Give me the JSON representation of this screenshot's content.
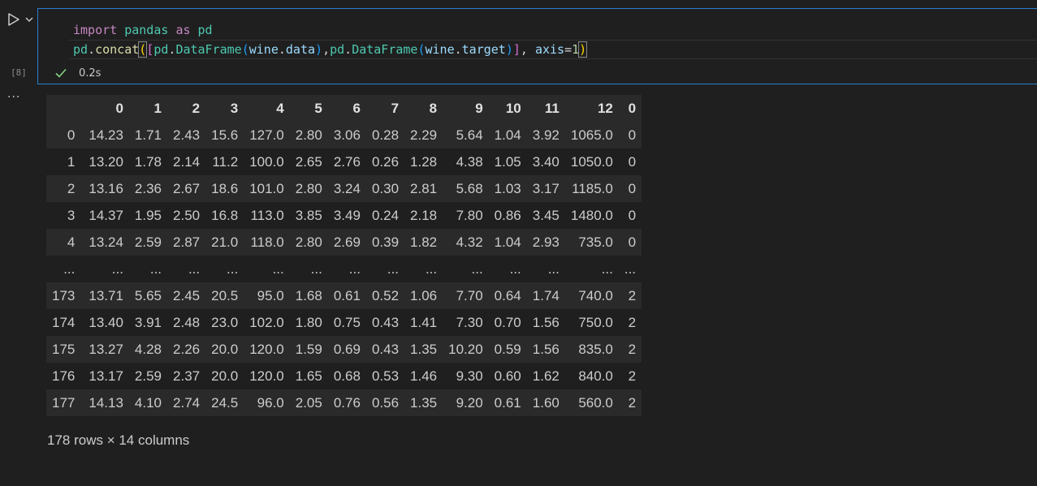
{
  "cell": {
    "execution_count": "[8]",
    "status_time": "0.2s",
    "code": {
      "line1": {
        "import_kw": "import",
        "module": "pandas",
        "as_kw": "as",
        "alias": "pd"
      },
      "line2": {
        "obj": "pd",
        "dot1": ".",
        "fn": "concat",
        "p1": "(",
        "b1": "[",
        "obj2": "pd",
        "dot2": ".",
        "cls1": "DataFrame",
        "p2": "(",
        "var1": "wine",
        "dot3": ".",
        "attr1": "data",
        "p3": ")",
        "comma1": ",",
        "obj3": "pd",
        "dot4": ".",
        "cls2": "DataFrame",
        "p4": "(",
        "var2": "wine",
        "dot5": ".",
        "attr2": "target",
        "p5": ")",
        "b2": "]",
        "comma2": ", ",
        "kwarg": "axis",
        "eq": "=",
        "num": "1",
        "p6": ")"
      }
    }
  },
  "output": {
    "columns": [
      "",
      "0",
      "1",
      "2",
      "3",
      "4",
      "5",
      "6",
      "7",
      "8",
      "9",
      "10",
      "11",
      "12",
      "0"
    ],
    "rows": [
      [
        "0",
        "14.23",
        "1.71",
        "2.43",
        "15.6",
        "127.0",
        "2.80",
        "3.06",
        "0.28",
        "2.29",
        "5.64",
        "1.04",
        "3.92",
        "1065.0",
        "0"
      ],
      [
        "1",
        "13.20",
        "1.78",
        "2.14",
        "11.2",
        "100.0",
        "2.65",
        "2.76",
        "0.26",
        "1.28",
        "4.38",
        "1.05",
        "3.40",
        "1050.0",
        "0"
      ],
      [
        "2",
        "13.16",
        "2.36",
        "2.67",
        "18.6",
        "101.0",
        "2.80",
        "3.24",
        "0.30",
        "2.81",
        "5.68",
        "1.03",
        "3.17",
        "1185.0",
        "0"
      ],
      [
        "3",
        "14.37",
        "1.95",
        "2.50",
        "16.8",
        "113.0",
        "3.85",
        "3.49",
        "0.24",
        "2.18",
        "7.80",
        "0.86",
        "3.45",
        "1480.0",
        "0"
      ],
      [
        "4",
        "13.24",
        "2.59",
        "2.87",
        "21.0",
        "118.0",
        "2.80",
        "2.69",
        "0.39",
        "1.82",
        "4.32",
        "1.04",
        "2.93",
        "735.0",
        "0"
      ],
      [
        "...",
        "...",
        "...",
        "...",
        "...",
        "...",
        "...",
        "...",
        "...",
        "...",
        "...",
        "...",
        "...",
        "...",
        "..."
      ],
      [
        "173",
        "13.71",
        "5.65",
        "2.45",
        "20.5",
        "95.0",
        "1.68",
        "0.61",
        "0.52",
        "1.06",
        "7.70",
        "0.64",
        "1.74",
        "740.0",
        "2"
      ],
      [
        "174",
        "13.40",
        "3.91",
        "2.48",
        "23.0",
        "102.0",
        "1.80",
        "0.75",
        "0.43",
        "1.41",
        "7.30",
        "0.70",
        "1.56",
        "750.0",
        "2"
      ],
      [
        "175",
        "13.27",
        "4.28",
        "2.26",
        "20.0",
        "120.0",
        "1.59",
        "0.69",
        "0.43",
        "1.35",
        "10.20",
        "0.59",
        "1.56",
        "835.0",
        "2"
      ],
      [
        "176",
        "13.17",
        "2.59",
        "2.37",
        "20.0",
        "120.0",
        "1.65",
        "0.68",
        "0.53",
        "1.46",
        "9.30",
        "0.60",
        "1.62",
        "840.0",
        "2"
      ],
      [
        "177",
        "14.13",
        "4.10",
        "2.74",
        "24.5",
        "96.0",
        "2.05",
        "0.76",
        "0.56",
        "1.35",
        "9.20",
        "0.61",
        "1.60",
        "560.0",
        "2"
      ]
    ],
    "summary": "178 rows × 14 columns",
    "more_icon": "ellipsis-icon"
  },
  "colors": {
    "focus_border": "#2b7fd1",
    "success": "#89d185",
    "background": "#1f1f1f"
  }
}
